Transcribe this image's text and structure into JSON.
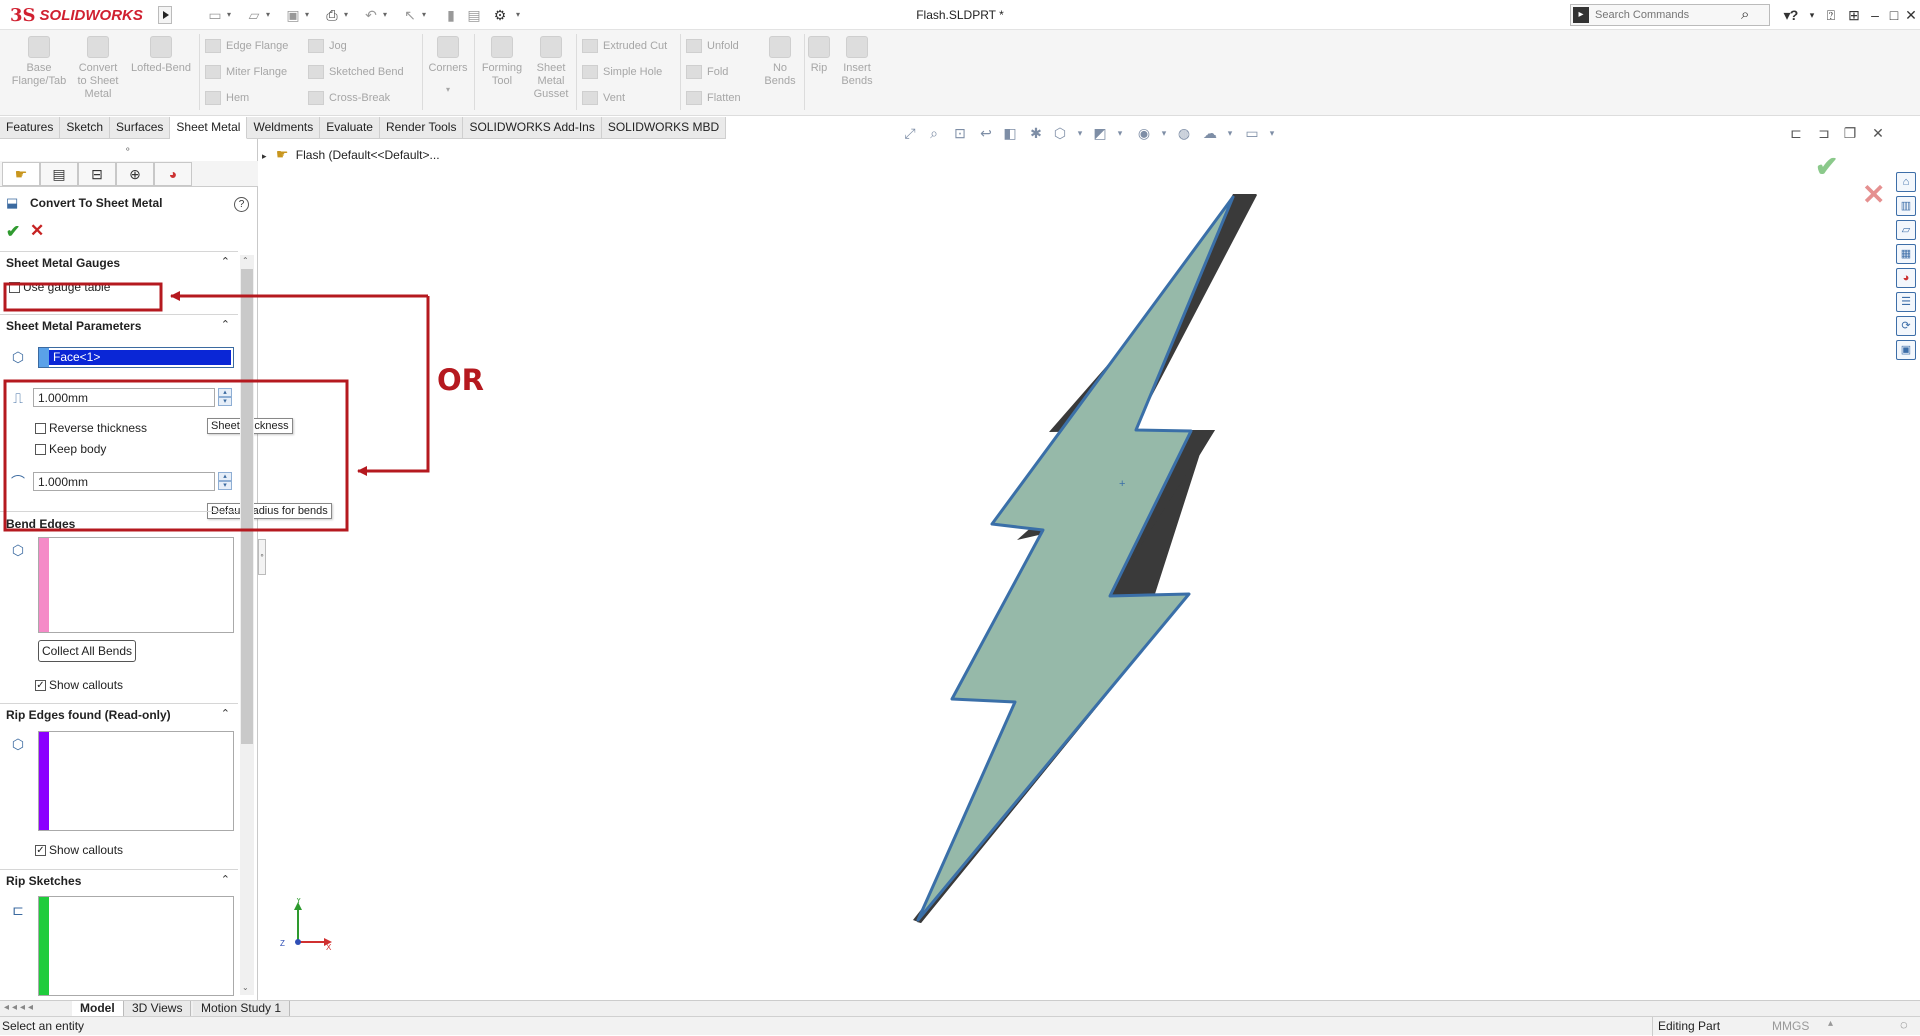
{
  "app": {
    "brand_ds": "3S",
    "brand_name": "SOLIDWORKS"
  },
  "document": {
    "title": "Flash.SLDPRT *"
  },
  "search": {
    "placeholder": "Search Commands"
  },
  "ribbon": {
    "big_tools": [
      {
        "label": "Base\nFlange/Tab"
      },
      {
        "label": "Convert\nto Sheet\nMetal"
      },
      {
        "label": "Lofted-Bend"
      },
      {
        "label": "Corners"
      },
      {
        "label": "Forming\nTool"
      },
      {
        "label": "Sheet\nMetal\nGusset"
      },
      {
        "label": "No\nBends"
      },
      {
        "label": "Rip"
      },
      {
        "label": "Insert\nBends"
      }
    ],
    "small_tools": [
      {
        "label": "Edge Flange"
      },
      {
        "label": "Miter Flange"
      },
      {
        "label": "Hem"
      },
      {
        "label": "Jog"
      },
      {
        "label": "Sketched Bend"
      },
      {
        "label": "Cross-Break"
      },
      {
        "label": "Extruded Cut"
      },
      {
        "label": "Simple Hole"
      },
      {
        "label": "Vent"
      },
      {
        "label": "Unfold"
      },
      {
        "label": "Fold"
      },
      {
        "label": "Flatten"
      }
    ]
  },
  "tabs": [
    "Features",
    "Sketch",
    "Surfaces",
    "Sheet Metal",
    "Weldments",
    "Evaluate",
    "Render Tools",
    "SOLIDWORKS Add-Ins",
    "SOLIDWORKS MBD"
  ],
  "property_manager": {
    "title": "Convert To Sheet Metal",
    "help": "?",
    "ok": "✔",
    "cancel": "✕",
    "gauges": {
      "heading": "Sheet Metal Gauges",
      "use_gauge_table": "Use gauge table"
    },
    "parameters": {
      "heading": "Sheet Metal Parameters",
      "face": "Face<1>",
      "thickness": "1.000mm",
      "reverse_thickness": "Reverse thickness",
      "keep_body": "Keep body",
      "radius": "1.000mm",
      "tooltip_thickness": "Sheet thickness",
      "tooltip_radius": "Default radius for bends"
    },
    "bend_edges": {
      "heading": "Bend Edges",
      "collect_button": "Collect All Bends",
      "show_callouts": "Show callouts",
      "color": "#f58ac7"
    },
    "rip_edges": {
      "heading": "Rip Edges found (Read-only)",
      "show_callouts": "Show callouts",
      "color": "#8b00ff"
    },
    "rip_sketches": {
      "heading": "Rip Sketches",
      "color": "#1fcc3c"
    }
  },
  "annotation": {
    "or_label": "OR",
    "color": "#b5191f"
  },
  "tree": {
    "root": "Flash  (Default<<Default>..."
  },
  "triad": {
    "y": "Y",
    "x": "X",
    "z": "Z"
  },
  "bottom_tabs": [
    "Model",
    "3D Views",
    "Motion Study 1"
  ],
  "status": {
    "left": "Select an entity",
    "mode": "Editing Part",
    "units": "MMGS"
  },
  "part": {
    "fill": "#96b9a9",
    "outline": "#3a6fa8",
    "side": "#3a3a3a"
  }
}
